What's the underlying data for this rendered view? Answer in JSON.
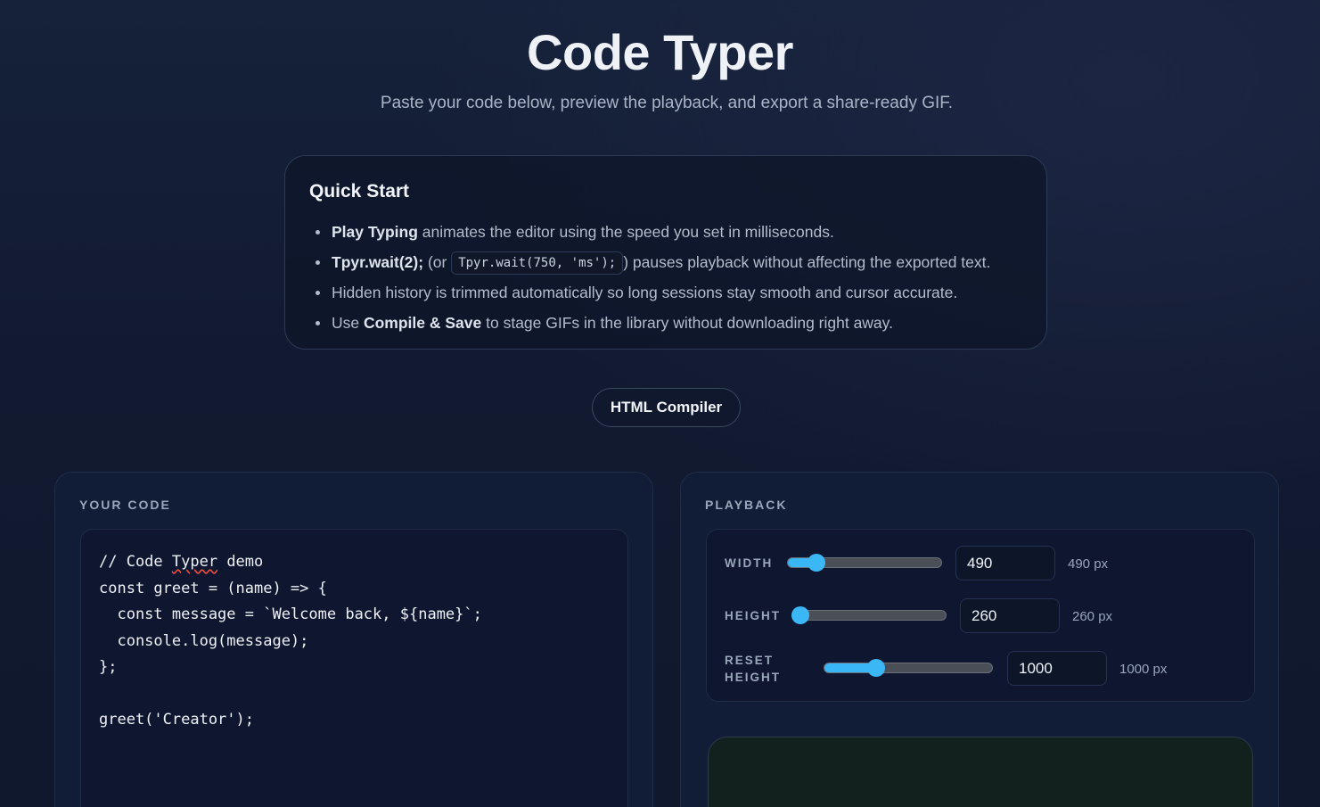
{
  "header": {
    "title": "Code Typer",
    "subtitle": "Paste your code below, preview the playback, and export a share-ready GIF."
  },
  "quick_start": {
    "title": "Quick Start",
    "items": [
      {
        "bold": "Play Typing",
        "text": " animates the editor using the speed you set in milliseconds."
      },
      {
        "bold": "Tpyr.wait(2);",
        "pre": " (or ",
        "code": "Tpyr.wait(750, 'ms');",
        "text": ") pauses playback without affecting the exported text."
      },
      {
        "text": "Hidden history is trimmed automatically so long sessions stay smooth and cursor accurate."
      },
      {
        "pre": "Use ",
        "bold": "Compile & Save",
        "text": " to stage GIFs in the library without downloading right away."
      }
    ]
  },
  "html_compiler_label": "HTML Compiler",
  "code_panel": {
    "label": "YOUR CODE",
    "lines": [
      "// Code Typer demo",
      "const greet = (name) => {",
      "  const message = `Welcome back, ${name}`;",
      "  console.log(message);",
      "};",
      "",
      "greet('Creator');"
    ]
  },
  "playback_panel": {
    "label": "PLAYBACK",
    "width": {
      "label": "WIDTH",
      "value": "490",
      "unit": "490 px",
      "fraction": 0.19
    },
    "height": {
      "label": "HEIGHT",
      "value": "260",
      "unit": "260 px",
      "fraction": 0.06
    },
    "reset_height": {
      "label_line1": "RESET",
      "label_line2": "HEIGHT",
      "value": "1000",
      "unit": "1000 px",
      "fraction": 0.31
    }
  },
  "colors": {
    "accent": "#38b6f5",
    "background": "#121a31",
    "preview_bg": "#13211e"
  }
}
